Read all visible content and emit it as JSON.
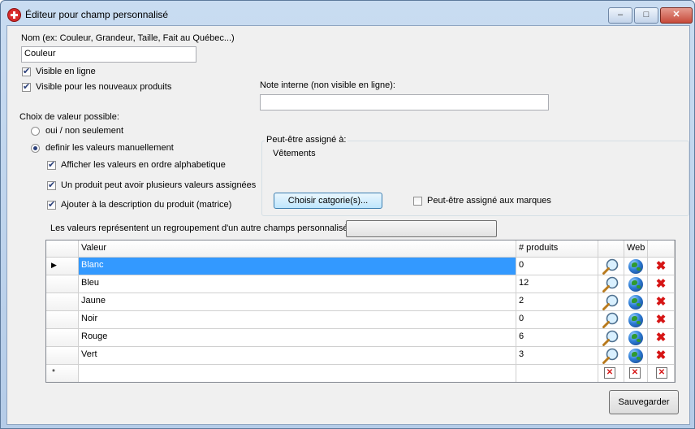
{
  "window": {
    "title": "Éditeur pour champ personnalisé",
    "min_label": "‒",
    "max_label": "□",
    "close_label": "✕"
  },
  "form": {
    "name_label": "Nom (ex: Couleur, Grandeur, Taille, Fait au Québec...)",
    "name_value": "Couleur",
    "visible_online": {
      "label": "Visible en ligne",
      "checked": true
    },
    "visible_new_products": {
      "label": "Visible pour les nouveaux produits",
      "checked": true
    },
    "internal_note_label": "Note interne (non visible en ligne):",
    "internal_note_value": "",
    "value_choice_label": "Choix de valeur possible:",
    "radio_yes_no": {
      "label": "oui / non seulement",
      "selected": false
    },
    "radio_manual": {
      "label": "definir les valeurs manuellement",
      "selected": true
    },
    "opt_alpha": {
      "label": "Afficher les valeurs en ordre alphabetique",
      "checked": true
    },
    "opt_multi": {
      "label": "Un produit peut avoir plusieurs valeurs assignées",
      "checked": true
    },
    "opt_desc": {
      "label": "Ajouter à la description du produit (matrice)",
      "checked": true
    },
    "assign_group_label": "Peut-être assigné à:",
    "assign_group_value": "Vêtements",
    "choose_category_button": "Choisir catgorie(s)...",
    "assign_brands": {
      "label": "Peut-être assigné aux marques",
      "checked": false
    },
    "grouping_label": "Les valeurs représentent un regroupement d'un autre champs personnalisé:",
    "grouping_value": ""
  },
  "grid": {
    "columns": [
      "Valeur",
      "# produits",
      "",
      "Web",
      ""
    ],
    "rows": [
      {
        "valeur": "Blanc",
        "produits": "0",
        "selected": true
      },
      {
        "valeur": "Bleu",
        "produits": "12"
      },
      {
        "valeur": "Jaune",
        "produits": "2"
      },
      {
        "valeur": "Noir",
        "produits": "0"
      },
      {
        "valeur": "Rouge",
        "produits": "6"
      },
      {
        "valeur": "Vert",
        "produits": "3"
      }
    ],
    "new_row_marker": "*",
    "current_row_marker": "▶",
    "icons": {
      "search": "magnifier-icon",
      "web": "globe-icon",
      "delete": "delete-x-icon"
    }
  },
  "save_button": "Sauvegarder"
}
